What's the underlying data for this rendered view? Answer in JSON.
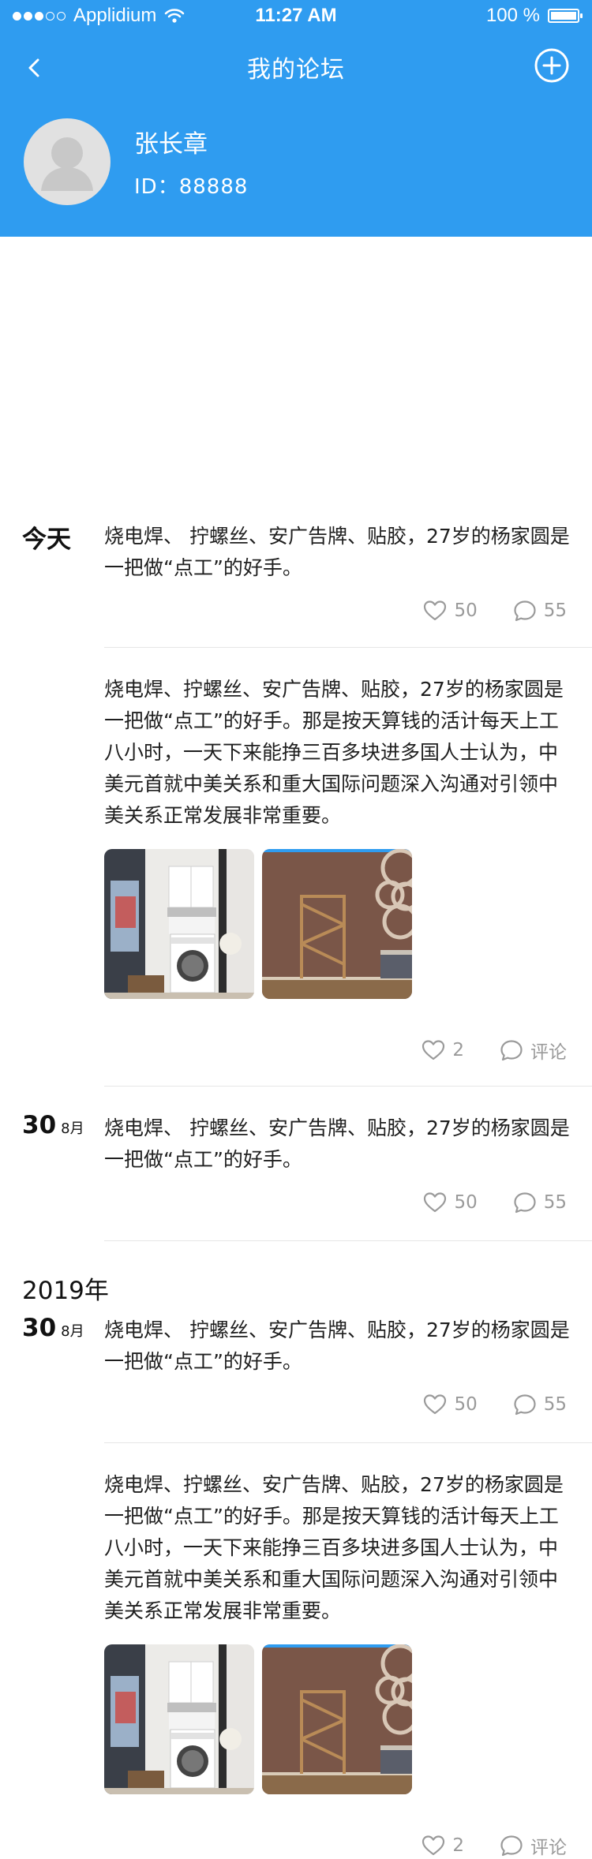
{
  "status_bar": {
    "carrier": "Applidium",
    "time": "11:27 AM",
    "battery": "100 %"
  },
  "nav": {
    "title": "我的论坛",
    "back_icon": "chevron-left-icon",
    "add_icon": "plus-circle-icon"
  },
  "profile": {
    "name": "张长章",
    "id": "ID：88888"
  },
  "colors": {
    "header_blue": "#2f9cf0",
    "icon_gray": "#9a9a9a",
    "divider": "#e6e6e6"
  },
  "feed": {
    "date_today": "今天",
    "date1_day": "30",
    "date1_month": "8月",
    "year": "2019年",
    "date2_day": "30",
    "date2_month": "8月",
    "posts": [
      {
        "text": "烧电焊、 拧螺丝、安广告牌、贴胶，27岁的杨家圆是一把做“点工”的好手。",
        "likes": "50",
        "comments": "55"
      },
      {
        "text": "烧电焊、拧螺丝、安广告牌、贴胶，27岁的杨家圆是一把做“点工”的好手。那是按天算钱的活计每天上工八小时，一天下来能挣三百多块进多国人士认为，中美元首就中美关系和重大国际问题深入沟通对引领中美关系正常发展非常重要。",
        "likes": "2",
        "comments": "评论"
      },
      {
        "text": "烧电焊、 拧螺丝、安广告牌、贴胶，27岁的杨家圆是一把做“点工”的好手。",
        "likes": "50",
        "comments": "55"
      },
      {
        "text": "烧电焊、 拧螺丝、安广告牌、贴胶，27岁的杨家圆是一把做“点工”的好手。",
        "likes": "50",
        "comments": "55"
      },
      {
        "text": "烧电焊、拧螺丝、安广告牌、贴胶，27岁的杨家圆是一把做“点工”的好手。那是按天算钱的活计每天上工八小时，一天下来能挣三百多块进多国人士认为，中美元首就中美关系和重大国际问题深入沟通对引领中美关系正常发展非常重要。",
        "likes": "2",
        "comments": "评论"
      }
    ]
  }
}
